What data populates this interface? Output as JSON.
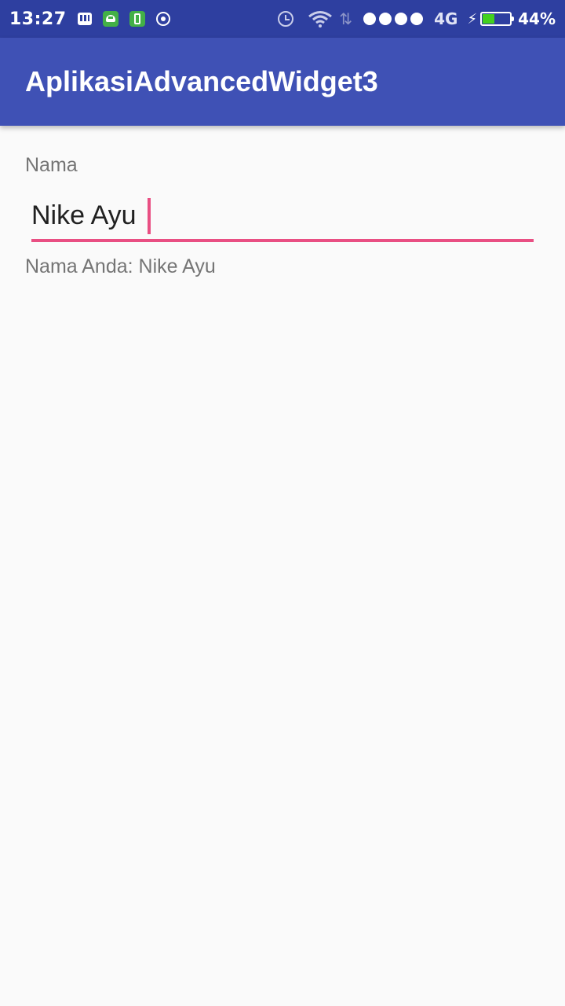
{
  "status_bar": {
    "time": "13:27",
    "network": "4G",
    "battery_percent": "44%",
    "battery_level": 0.44,
    "notification_icons": [
      "bbm-icon",
      "android-icon",
      "battery-saver-icon",
      "whatsapp-icon"
    ],
    "colors": {
      "background": "#2e3fa0",
      "battery_fill": "#43d11e"
    }
  },
  "app_bar": {
    "title": "AplikasiAdvancedWidget3",
    "color": "#3f51b5"
  },
  "form": {
    "label": "Nama",
    "input_value": "Nike Ayu",
    "accent_color": "#e94f83"
  },
  "output": {
    "text": "Nama Anda: Nike Ayu"
  }
}
